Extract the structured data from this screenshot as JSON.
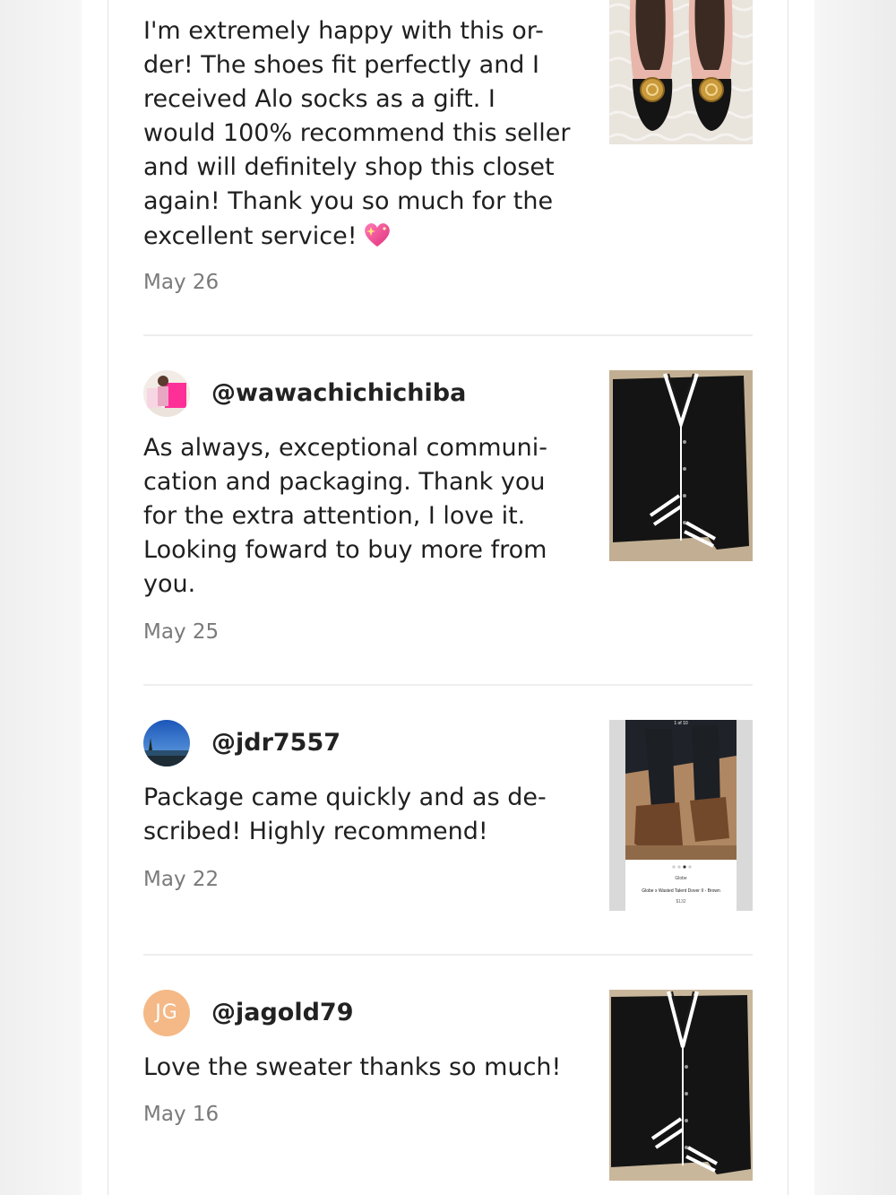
{
  "reviews": [
    {
      "username": "",
      "text_lines": [
        "I'm extremely happy with this or-",
        "der! The shoes fit perfectly and I",
        "received Alo socks as a gift. I",
        "would 100% recommend this seller",
        "and will definitely shop this closet",
        "again! Thank you so much for the",
        "excellent service!"
      ],
      "emoji": "sparkling-heart",
      "date": "May 26",
      "photo": "pink-black-ballet-flats"
    },
    {
      "username": "@wawachichichiba",
      "text_lines": [
        "As always, exceptional communi-",
        "cation and packaging. Thank you",
        "for the extra attention, I love it.",
        "Looking foward to buy more from",
        "you."
      ],
      "date": "May 25",
      "photo": "black-cardigan-white-stripes"
    },
    {
      "username": "@jdr7557",
      "text_lines": [
        "Package came quickly and as de-",
        "scribed! Highly recommend!"
      ],
      "date": "May 22",
      "photo": "brown-boots-listing-screenshot",
      "photo_caption": {
        "counter": "1 of 10",
        "brand": "Globe",
        "title": "Globe x Wasted Talent Dover II - Brown",
        "price": "$132"
      }
    },
    {
      "username": "@jagold79",
      "initials": "JG",
      "text_lines": [
        "Love the sweater thanks so much!"
      ],
      "date": "May 16",
      "photo": "black-cardigan-white-stripes"
    }
  ],
  "colors": {
    "username": "#222222",
    "text": "#1f1f1f",
    "date": "#7a7a7a",
    "divider": "#eeeeee",
    "initials_avatar": "#f4b986"
  }
}
